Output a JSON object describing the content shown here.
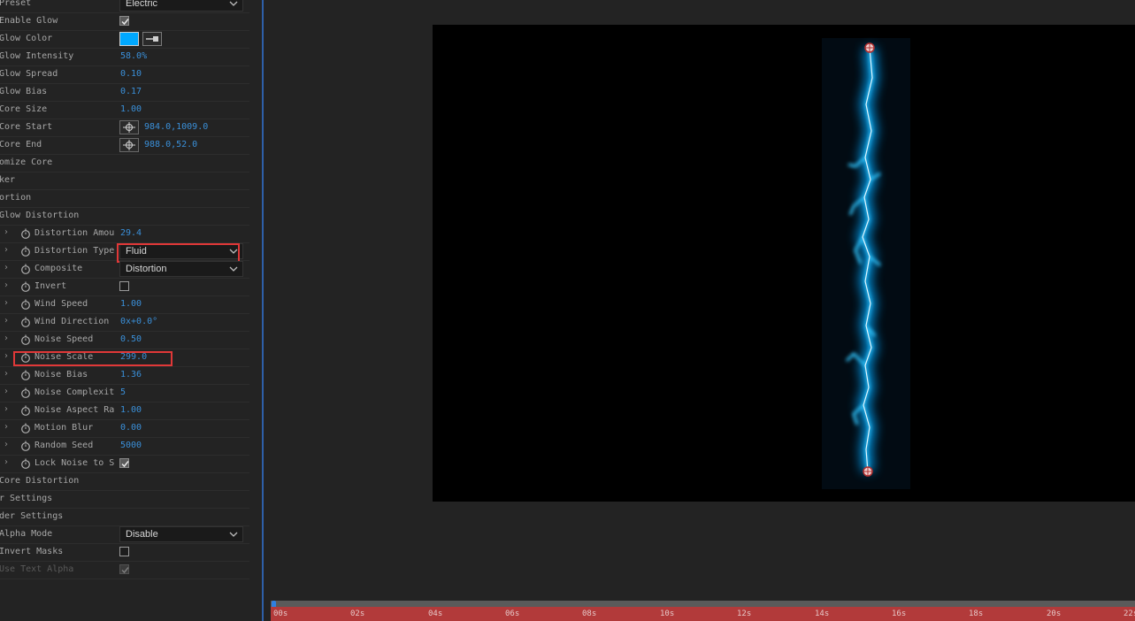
{
  "effect_controls": {
    "rows": [
      {
        "label": "Preset",
        "type": "dropdown",
        "value": "Electric"
      },
      {
        "label": "Enable Glow",
        "type": "checkbox",
        "checked": true
      },
      {
        "label": "Glow Color",
        "type": "color",
        "color": "#00a8ff"
      },
      {
        "label": "Glow Intensity",
        "type": "value",
        "value": "58.0%"
      },
      {
        "label": "Glow Spread",
        "type": "value",
        "value": "0.10"
      },
      {
        "label": "Glow Bias",
        "type": "value",
        "value": "0.17"
      },
      {
        "label": "Core Size",
        "type": "value",
        "value": "1.00"
      },
      {
        "label": "Core Start",
        "type": "point",
        "value": "984.0,1009.0"
      },
      {
        "label": "Core End",
        "type": "point",
        "value": "988.0,52.0"
      },
      {
        "label": "omize Core",
        "type": "group"
      },
      {
        "label": "ker",
        "type": "group"
      },
      {
        "label": "ortion",
        "type": "group"
      },
      {
        "label": "Glow Distortion",
        "type": "group"
      },
      {
        "label": "Distortion Amou",
        "type": "value",
        "value": "29.4",
        "sub": true
      },
      {
        "label": "Distortion Type",
        "type": "dropdown",
        "value": "Fluid",
        "sub": true,
        "highlight": true
      },
      {
        "label": "Composite",
        "type": "dropdown",
        "value": "Distortion",
        "sub": true
      },
      {
        "label": "Invert",
        "type": "checkbox",
        "checked": false,
        "sub": true
      },
      {
        "label": "Wind Speed",
        "type": "value",
        "value": "1.00",
        "sub": true
      },
      {
        "label": "Wind Direction",
        "type": "value",
        "value": "0x+0.0°",
        "sub": true
      },
      {
        "label": "Noise Speed",
        "type": "value",
        "value": "0.50",
        "sub": true
      },
      {
        "label": "Noise Scale",
        "type": "value",
        "value": "299.0",
        "sub": true,
        "highlight": true
      },
      {
        "label": "Noise Bias",
        "type": "value",
        "value": "1.36",
        "sub": true
      },
      {
        "label": "Noise Complexit",
        "type": "value",
        "value": "5",
        "sub": true
      },
      {
        "label": "Noise Aspect Ra",
        "type": "value",
        "value": "1.00",
        "sub": true
      },
      {
        "label": "Motion Blur",
        "type": "value",
        "value": "0.00",
        "sub": true
      },
      {
        "label": "Random Seed",
        "type": "value",
        "value": "5000",
        "sub": true
      },
      {
        "label": "Lock Noise to S",
        "type": "checkbox",
        "checked": true,
        "sub": true
      },
      {
        "label": "Core Distortion",
        "type": "group"
      },
      {
        "label": "r Settings",
        "type": "group"
      },
      {
        "label": "der Settings",
        "type": "group"
      },
      {
        "label": "Alpha Mode",
        "type": "dropdown",
        "value": "Disable"
      },
      {
        "label": "Invert Masks",
        "type": "checkbox",
        "checked": false
      },
      {
        "label": "Use Text Alpha",
        "type": "checkbox",
        "checked": true,
        "disabled": true
      }
    ]
  },
  "timeline": {
    "ticks": [
      "00s",
      "02s",
      "04s",
      "06s",
      "08s",
      "10s",
      "12s",
      "14s",
      "16s",
      "18s",
      "20s",
      "22s"
    ]
  },
  "colors": {
    "accent_blue": "#3a8fd8",
    "highlight_red": "#e03838",
    "glow": "#00a8ff",
    "ruler": "#b23a3a"
  }
}
